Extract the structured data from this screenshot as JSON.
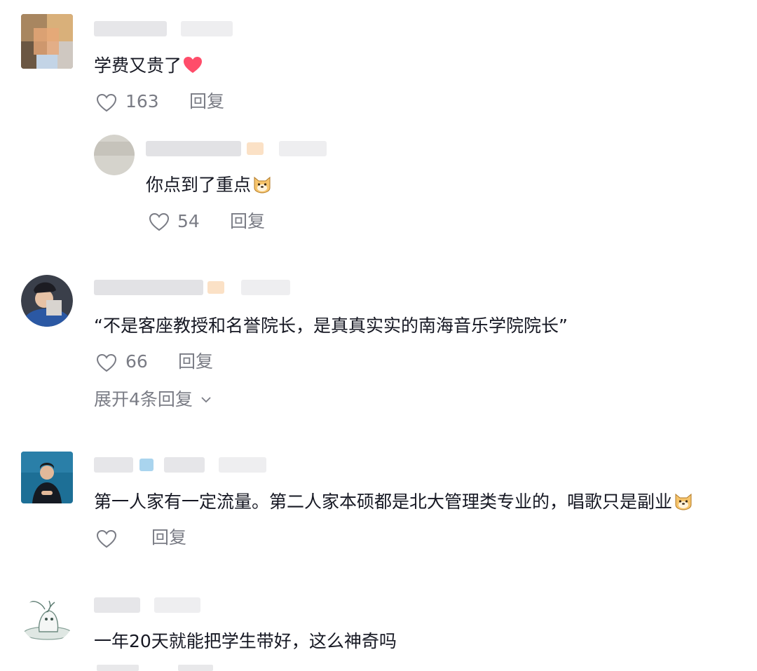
{
  "comments": [
    {
      "text": "学费又贵了",
      "likes": "163",
      "reply_label": "回复",
      "emoji": "heart-emoji"
    },
    {
      "text": "你点到了重点",
      "likes": "54",
      "reply_label": "回复",
      "emoji": "dog-emoji"
    },
    {
      "text": "“不是客座教授和名誉院长，是真真实实的南海音乐学院院长”",
      "likes": "66",
      "reply_label": "回复",
      "expand_label": "展开4条回复"
    },
    {
      "text": "第一人家有一定流量。第二人家本硕都是北大管理类专业的，唱歌只是副业",
      "likes": "",
      "reply_label": "回复",
      "emoji": "dog-emoji"
    },
    {
      "text": "一年20天就能把学生带好，这么神奇吗",
      "reply_label": "回复"
    }
  ],
  "colors": {
    "text": "#161823",
    "meta": "#7a7c85",
    "heart_emoji": "#ff4d6a"
  }
}
